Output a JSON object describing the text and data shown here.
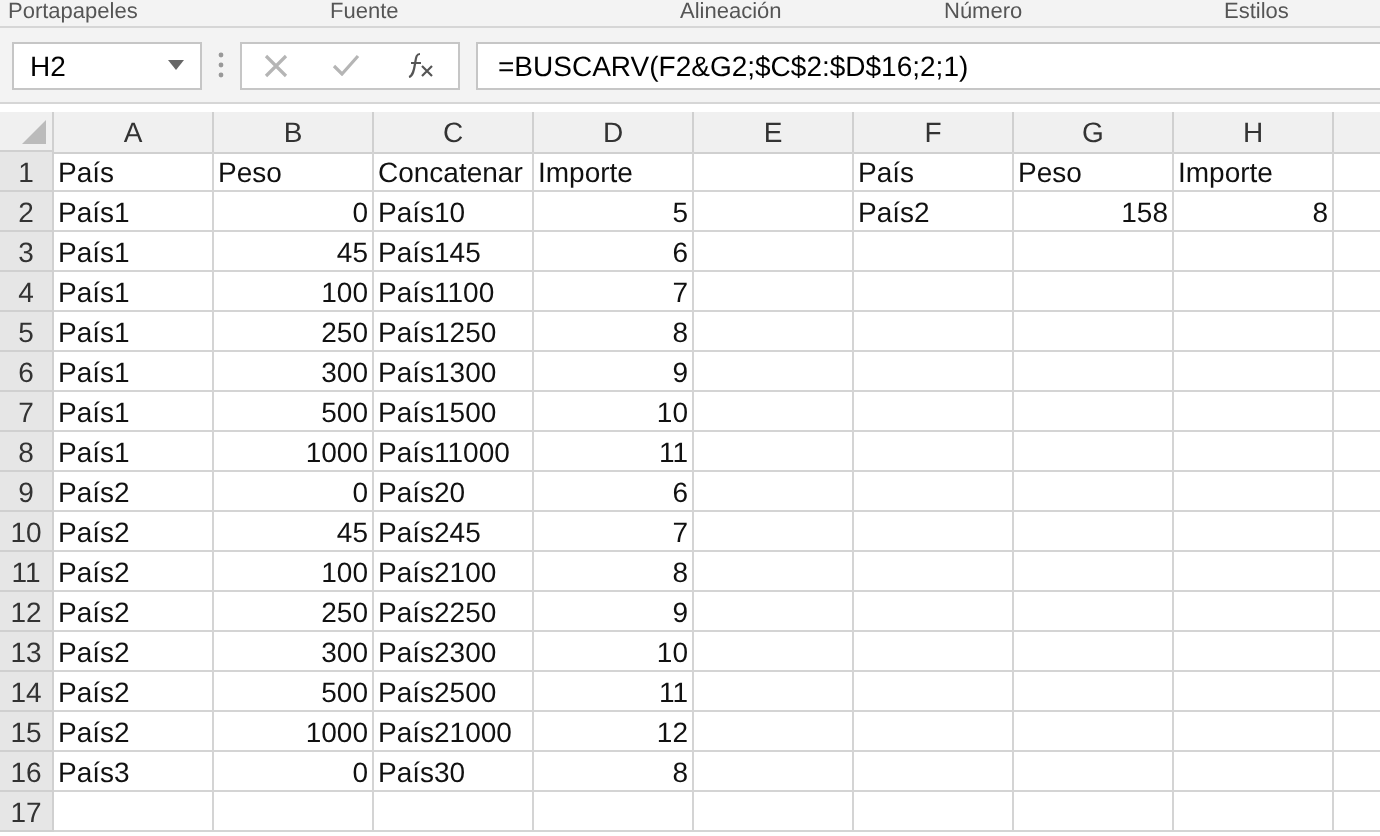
{
  "ribbon_groups": [
    {
      "label": "Portapapeles"
    },
    {
      "label": "Fuente"
    },
    {
      "label": "Alineación"
    },
    {
      "label": "Número"
    },
    {
      "label": "Estilos"
    }
  ],
  "formula_bar": {
    "name_box": "H2",
    "formula": "=BUSCARV(F2&G2;$C$2:$D$16;2;1)"
  },
  "columns": [
    "A",
    "B",
    "C",
    "D",
    "E",
    "F",
    "G",
    "H"
  ],
  "row_numbers": [
    "1",
    "2",
    "3",
    "4",
    "5",
    "6",
    "7",
    "8",
    "9",
    "10",
    "11",
    "12",
    "13",
    "14",
    "15",
    "16",
    "17"
  ],
  "table": {
    "rows": [
      [
        {
          "text": "País",
          "kind": "text"
        },
        {
          "text": "Peso",
          "kind": "text"
        },
        {
          "text": "Concatenar",
          "kind": "text"
        },
        {
          "text": "Importe",
          "kind": "text"
        }
      ],
      [
        {
          "text": "País1",
          "kind": "text"
        },
        {
          "text": "0",
          "kind": "number"
        },
        {
          "text": "País10",
          "kind": "text"
        },
        {
          "text": "5",
          "kind": "number"
        }
      ],
      [
        {
          "text": "País1",
          "kind": "text"
        },
        {
          "text": "45",
          "kind": "number"
        },
        {
          "text": "País145",
          "kind": "text"
        },
        {
          "text": "6",
          "kind": "number"
        }
      ],
      [
        {
          "text": "País1",
          "kind": "text"
        },
        {
          "text": "100",
          "kind": "number"
        },
        {
          "text": "País1100",
          "kind": "text"
        },
        {
          "text": "7",
          "kind": "number"
        }
      ],
      [
        {
          "text": "País1",
          "kind": "text"
        },
        {
          "text": "250",
          "kind": "number"
        },
        {
          "text": "País1250",
          "kind": "text"
        },
        {
          "text": "8",
          "kind": "number"
        }
      ],
      [
        {
          "text": "País1",
          "kind": "text"
        },
        {
          "text": "300",
          "kind": "number"
        },
        {
          "text": "País1300",
          "kind": "text"
        },
        {
          "text": "9",
          "kind": "number"
        }
      ],
      [
        {
          "text": "País1",
          "kind": "text"
        },
        {
          "text": "500",
          "kind": "number"
        },
        {
          "text": "País1500",
          "kind": "text"
        },
        {
          "text": "10",
          "kind": "number"
        }
      ],
      [
        {
          "text": "País1",
          "kind": "text"
        },
        {
          "text": "1000",
          "kind": "number"
        },
        {
          "text": "País11000",
          "kind": "text"
        },
        {
          "text": "11",
          "kind": "number"
        }
      ],
      [
        {
          "text": "País2",
          "kind": "text"
        },
        {
          "text": "0",
          "kind": "number"
        },
        {
          "text": "País20",
          "kind": "text"
        },
        {
          "text": "6",
          "kind": "number"
        }
      ],
      [
        {
          "text": "País2",
          "kind": "text"
        },
        {
          "text": "45",
          "kind": "number"
        },
        {
          "text": "País245",
          "kind": "text"
        },
        {
          "text": "7",
          "kind": "number"
        }
      ],
      [
        {
          "text": "País2",
          "kind": "text"
        },
        {
          "text": "100",
          "kind": "number"
        },
        {
          "text": "País2100",
          "kind": "text"
        },
        {
          "text": "8",
          "kind": "number"
        }
      ],
      [
        {
          "text": "País2",
          "kind": "text"
        },
        {
          "text": "250",
          "kind": "number"
        },
        {
          "text": "País2250",
          "kind": "text"
        },
        {
          "text": "9",
          "kind": "number"
        }
      ],
      [
        {
          "text": "País2",
          "kind": "text"
        },
        {
          "text": "300",
          "kind": "number"
        },
        {
          "text": "País2300",
          "kind": "text"
        },
        {
          "text": "10",
          "kind": "number"
        }
      ],
      [
        {
          "text": "País2",
          "kind": "text"
        },
        {
          "text": "500",
          "kind": "number"
        },
        {
          "text": "País2500",
          "kind": "text"
        },
        {
          "text": "11",
          "kind": "number"
        }
      ],
      [
        {
          "text": "País2",
          "kind": "text"
        },
        {
          "text": "1000",
          "kind": "number"
        },
        {
          "text": "País21000",
          "kind": "text"
        },
        {
          "text": "12",
          "kind": "number"
        }
      ],
      [
        {
          "text": "País3",
          "kind": "text"
        },
        {
          "text": "0",
          "kind": "number"
        },
        {
          "text": "País30",
          "kind": "text"
        },
        {
          "text": "8",
          "kind": "number"
        }
      ]
    ]
  },
  "lookup": {
    "rows": [
      [
        {
          "text": "País",
          "kind": "text"
        },
        {
          "text": "Peso",
          "kind": "text"
        },
        {
          "text": "Importe",
          "kind": "text"
        }
      ],
      [
        {
          "text": "País2",
          "kind": "text"
        },
        {
          "text": "158",
          "kind": "number"
        },
        {
          "text": "8",
          "kind": "number"
        }
      ]
    ]
  }
}
